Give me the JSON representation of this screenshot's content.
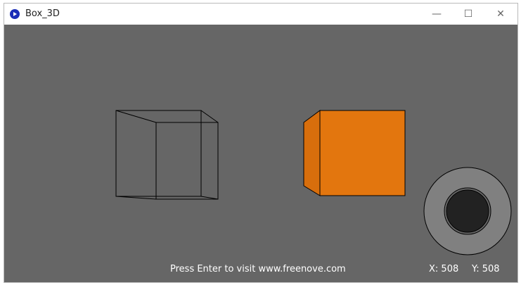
{
  "window": {
    "title": "Box_3D",
    "controls": {
      "minimize_glyph": "—",
      "maximize_glyph": "☐",
      "close_glyph": "✕"
    }
  },
  "canvas": {
    "background": "#666666",
    "wireframe_box_color": "#000000",
    "solid_box_color": "#e3760e",
    "joystick_ring_color": "#808080",
    "joystick_knob_color": "#222222",
    "hint_text": "Press Enter to visit www.freenove.com",
    "x_readout": "X: 508",
    "y_readout": "Y: 508"
  }
}
